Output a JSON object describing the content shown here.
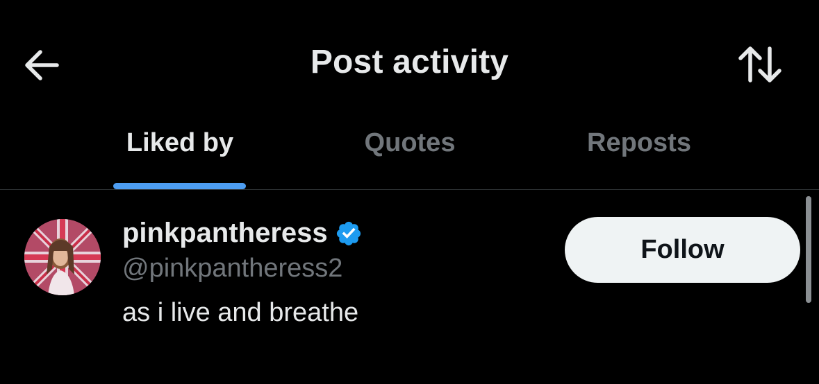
{
  "header": {
    "title": "Post activity",
    "back_icon": "arrow-left-icon",
    "sort_icon": "sort-arrows-icon"
  },
  "tabs": [
    {
      "label": "Liked by",
      "active": true
    },
    {
      "label": "Quotes",
      "active": false
    },
    {
      "label": "Reposts",
      "active": false
    }
  ],
  "users": [
    {
      "display_name": "pinkpantheress",
      "handle": "@pinkpantheress2",
      "bio": "as i live and breathe",
      "verified": true,
      "follow_label": "Follow"
    }
  ],
  "colors": {
    "background": "#000000",
    "primary_text": "#e7e9ea",
    "secondary_text": "#71767b",
    "accent": "#4d9df1",
    "verified_badge": "#1d9bf0",
    "follow_button_bg": "#eff3f4"
  }
}
